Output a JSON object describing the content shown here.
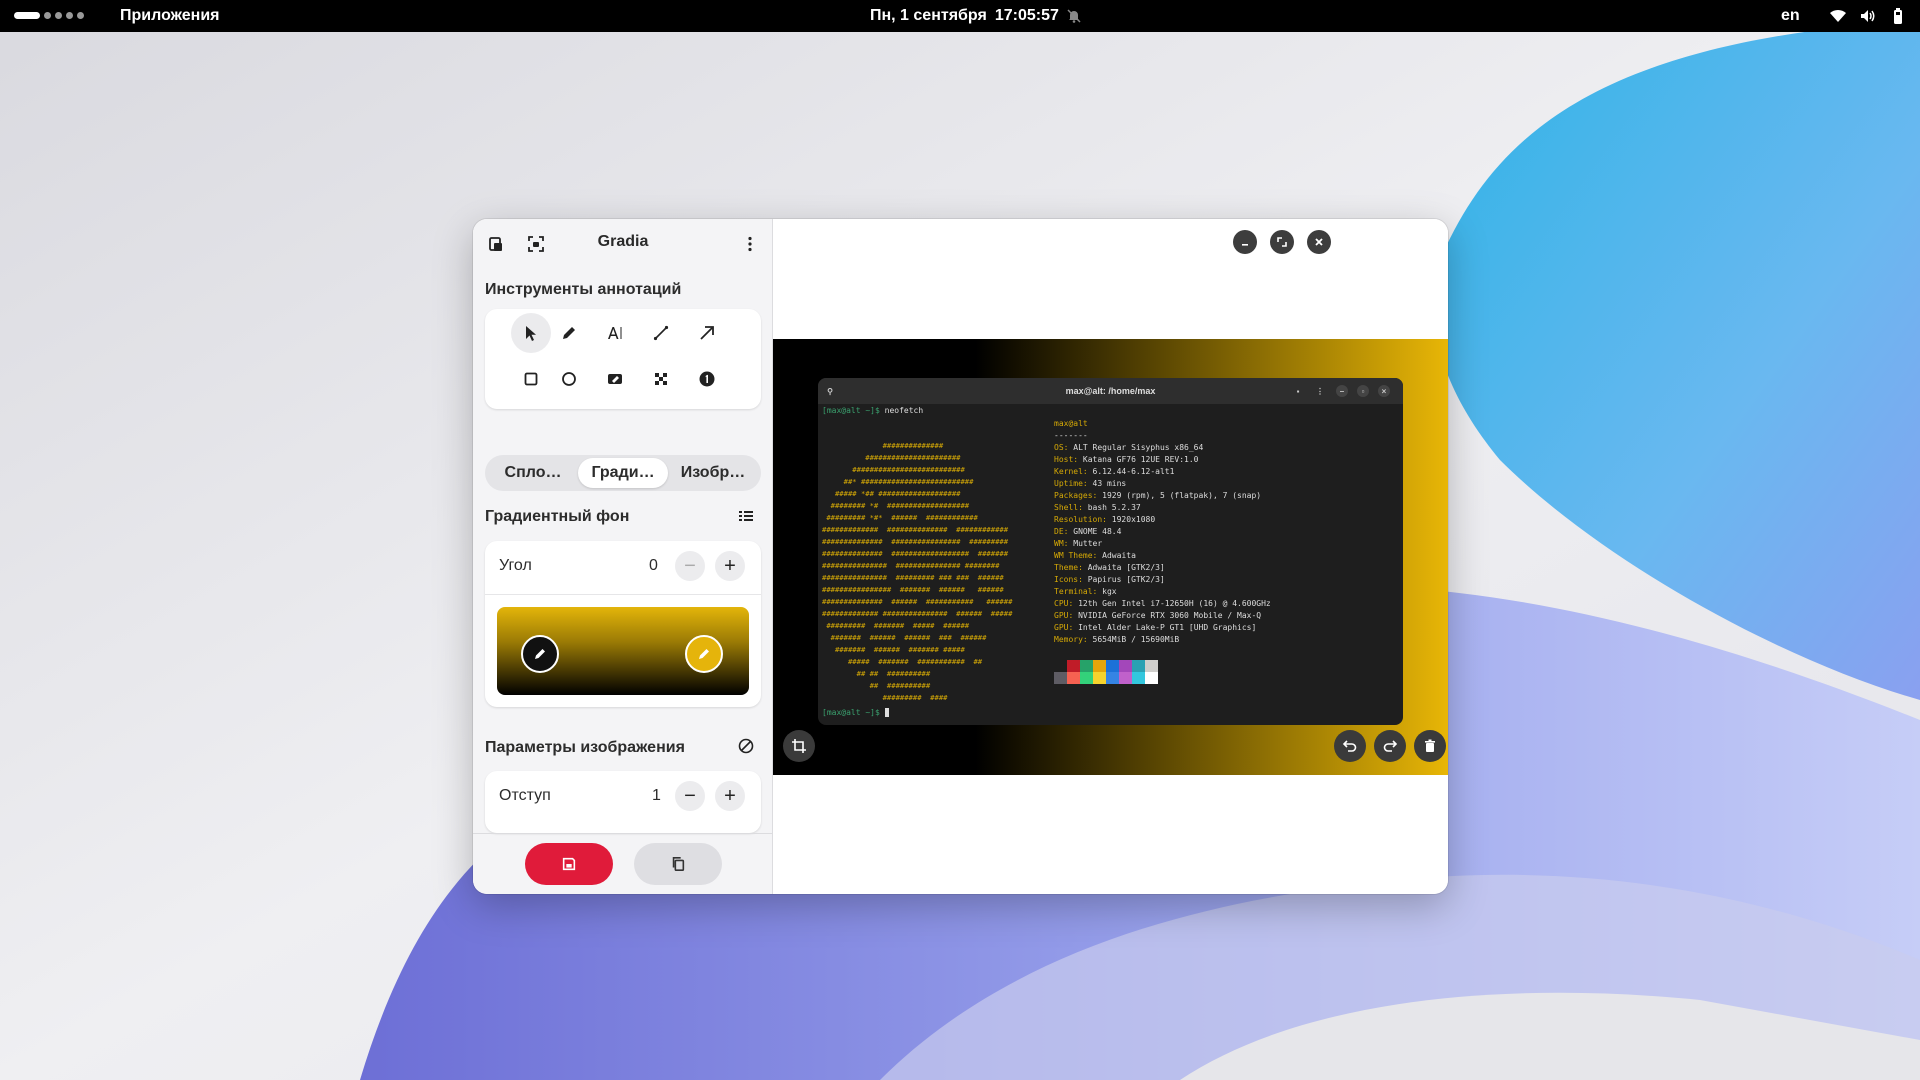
{
  "topbar": {
    "apps": "Приложения",
    "date": "Пн, 1 сентября",
    "time": "17:05:57",
    "lang": "en"
  },
  "window": {
    "title": "Gradia",
    "annotations_title": "Инструменты аннотаций",
    "tools_row1": [
      "select-icon",
      "pen-icon",
      "text-icon",
      "line-icon",
      "arrow-icon"
    ],
    "tools_row2": [
      "rectangle-icon",
      "circle-icon",
      "highlighter-icon",
      "pixelate-icon",
      "number-icon"
    ],
    "bg_tabs": [
      "Спло…",
      "Гради…",
      "Изобр…"
    ],
    "active_bg_tab": 1,
    "gradient_title": "Градиентный фон",
    "angle_label": "Угол",
    "angle_value": "0",
    "gradient_colors": [
      "#000000",
      "#e3b50a"
    ],
    "image_params_title": "Параметры изображения",
    "padding_label": "Отступ",
    "padding_value": "1"
  },
  "terminal": {
    "title": "max@alt: /home/max",
    "prompt": "[max@alt ~]$",
    "command": "neofetch",
    "user_host": "max@alt",
    "separator": "-------",
    "info": [
      {
        "k": "OS",
        "v": "ALT Regular Sisyphus x86_64"
      },
      {
        "k": "Host",
        "v": "Katana GF76 12UE REV:1.0"
      },
      {
        "k": "Kernel",
        "v": "6.12.44-6.12-alt1"
      },
      {
        "k": "Uptime",
        "v": "43 mins"
      },
      {
        "k": "Packages",
        "v": "1929 (rpm), 5 (flatpak), 7 (snap)"
      },
      {
        "k": "Shell",
        "v": "bash 5.2.37"
      },
      {
        "k": "Resolution",
        "v": "1920x1080"
      },
      {
        "k": "DE",
        "v": "GNOME 48.4"
      },
      {
        "k": "WM",
        "v": "Mutter"
      },
      {
        "k": "WM Theme",
        "v": "Adwaita"
      },
      {
        "k": "Theme",
        "v": "Adwaita [GTK2/3]"
      },
      {
        "k": "Icons",
        "v": "Papirus [GTK2/3]"
      },
      {
        "k": "Terminal",
        "v": "kgx"
      },
      {
        "k": "CPU",
        "v": "12th Gen Intel i7-12650H (16) @ 4.600GHz"
      },
      {
        "k": "GPU",
        "v": "NVIDIA GeForce RTX 3060 Mobile / Max-Q"
      },
      {
        "k": "GPU",
        "v": "Intel Alder Lake-P GT1 [UHD Graphics]"
      },
      {
        "k": "Memory",
        "v": "5654MiB / 15690MiB"
      }
    ],
    "palette": [
      "#1e1e1e",
      "#c01c28",
      "#26a269",
      "#e5a50a",
      "#1c71d8",
      "#a347ba",
      "#2aa1b3",
      "#d0cfcc",
      "#5e5c64",
      "#f66151",
      "#33d17a",
      "#f6d32d",
      "#3584e4",
      "#c061cb",
      "#33c7de",
      "#ffffff"
    ]
  },
  "colors": {
    "accent_red": "#e01b3a",
    "gradient_yellow": "#e8b606"
  }
}
